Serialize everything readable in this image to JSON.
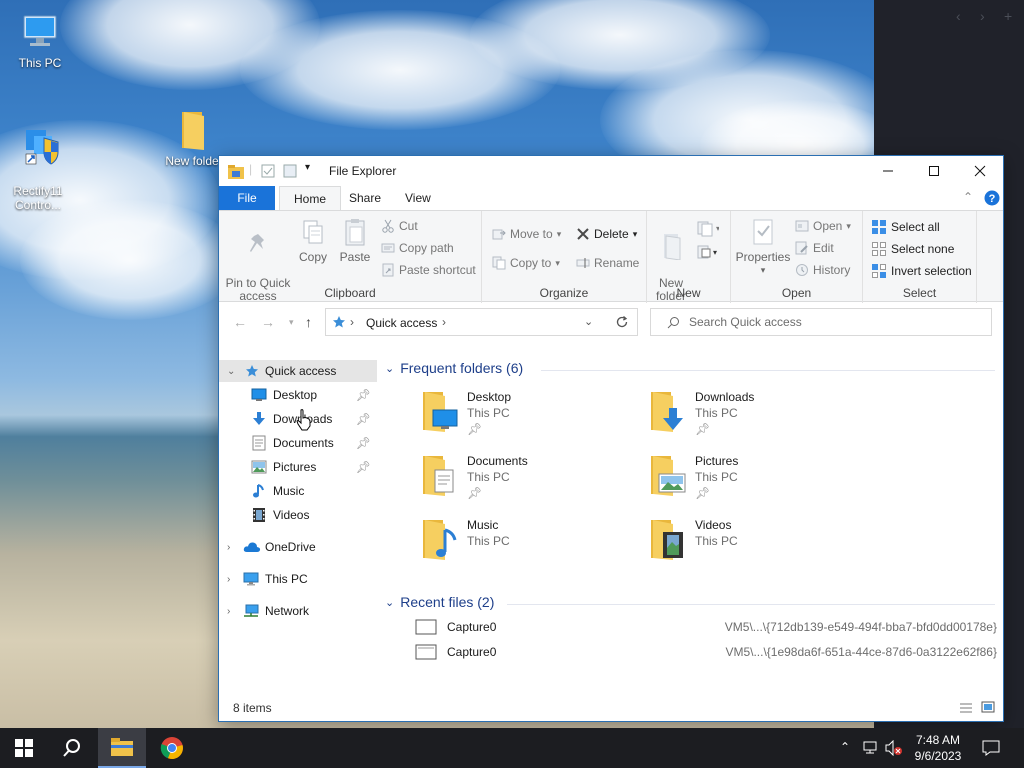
{
  "desktop": {
    "icons": [
      {
        "label": "This PC"
      },
      {
        "label": "Rectify11\nContro..."
      },
      {
        "label": "New folde"
      }
    ]
  },
  "window": {
    "title": "File Explorer",
    "tabs": {
      "file": "File",
      "home": "Home",
      "share": "Share",
      "view": "View"
    },
    "ribbon": {
      "clipboard": {
        "label": "Clipboard",
        "pin": "Pin to Quick\naccess",
        "copy": "Copy",
        "paste": "Paste",
        "cut": "Cut",
        "copy_path": "Copy path",
        "paste_shortcut": "Paste shortcut"
      },
      "organize": {
        "label": "Organize",
        "move_to": "Move to",
        "copy_to": "Copy to",
        "delete": "Delete",
        "rename": "Rename"
      },
      "new": {
        "label": "New",
        "new_folder": "New\nfolder"
      },
      "open": {
        "label": "Open",
        "properties": "Properties",
        "open": "Open",
        "edit": "Edit",
        "history": "History"
      },
      "select": {
        "label": "Select",
        "select_all": "Select all",
        "select_none": "Select none",
        "invert": "Invert selection"
      }
    },
    "address": {
      "location": "Quick access"
    },
    "search": {
      "placeholder": "Search Quick access"
    },
    "nav": {
      "quick_access": "Quick access",
      "items": [
        "Desktop",
        "Downloads",
        "Documents",
        "Pictures",
        "Music",
        "Videos"
      ],
      "onedrive": "OneDrive",
      "this_pc": "This PC",
      "network": "Network"
    },
    "frequent": {
      "heading": "Frequent folders (6)",
      "folders": [
        {
          "name": "Desktop",
          "location": "This PC",
          "pinned": true
        },
        {
          "name": "Downloads",
          "location": "This PC",
          "pinned": true
        },
        {
          "name": "Documents",
          "location": "This PC",
          "pinned": true
        },
        {
          "name": "Pictures",
          "location": "This PC",
          "pinned": true
        },
        {
          "name": "Music",
          "location": "This PC",
          "pinned": false
        },
        {
          "name": "Videos",
          "location": "This PC",
          "pinned": false
        }
      ]
    },
    "recent": {
      "heading": "Recent files (2)",
      "files": [
        {
          "name": "Capture0",
          "path": "VM5\\...\\{712db139-e549-494f-bba7-bfd0dd00178e}"
        },
        {
          "name": "Capture0",
          "path": "VM5\\...\\{1e98da6f-651a-44ce-87d6-0a3122e62f86}"
        }
      ]
    },
    "status": {
      "items": "8 items"
    }
  },
  "taskbar": {
    "time": "7:48 AM",
    "date": "9/6/2023"
  },
  "colors": {
    "accent": "#1a73d9",
    "folder": "#f0c24a",
    "link": "#1e3f8a",
    "taskbar": "#1c1d21"
  }
}
